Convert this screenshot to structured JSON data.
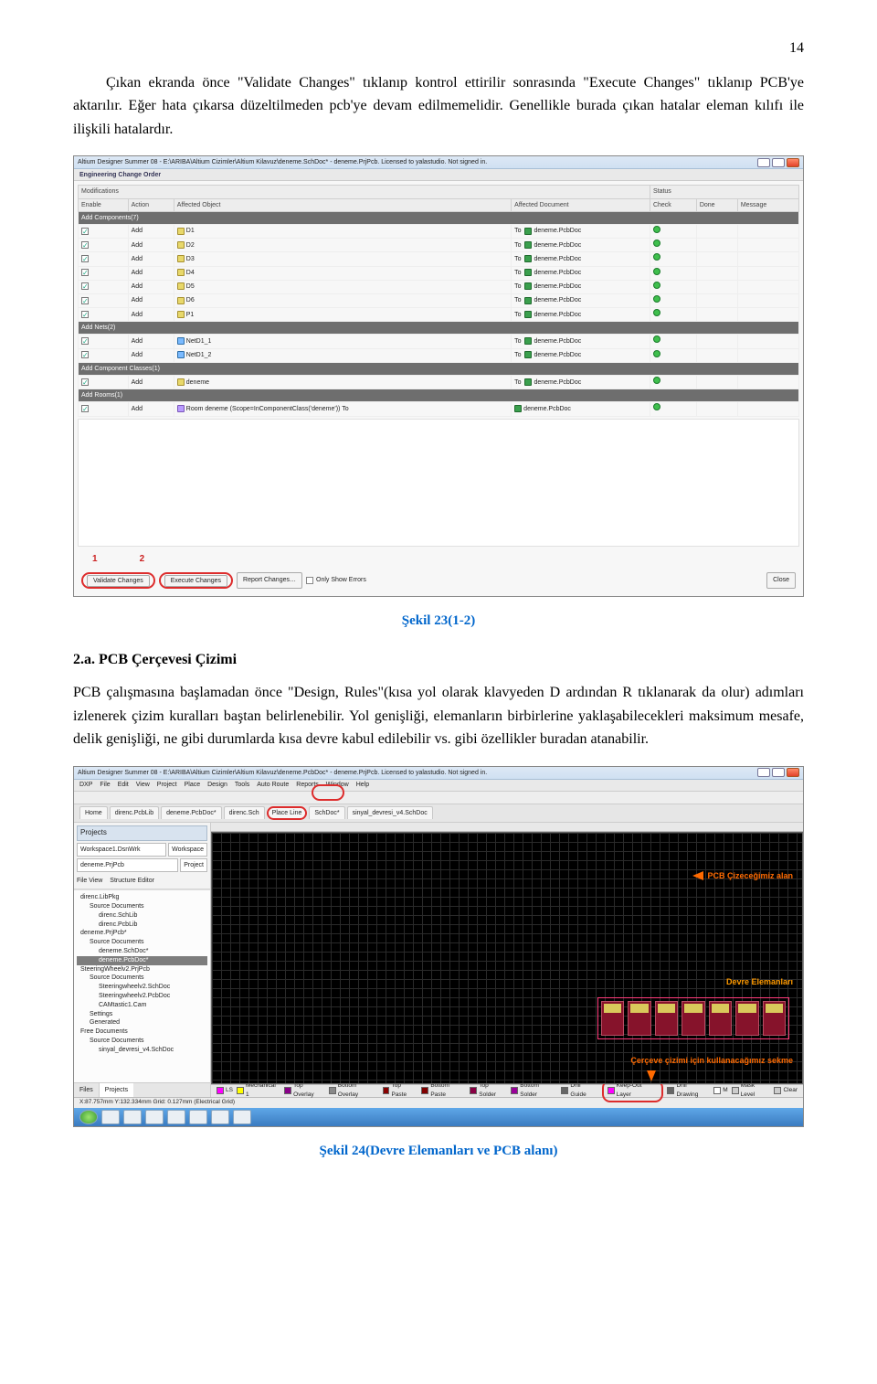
{
  "page_number": "14",
  "paragraphs": {
    "p1": "Çıkan ekranda önce \"Validate Changes\" tıklanıp kontrol ettirilir sonrasında \"Execute Changes\" tıklanıp PCB'ye aktarılır. Eğer hata çıkarsa düzeltilmeden pcb'ye devam edilmemelidir. Genellikle burada çıkan hatalar eleman kılıfı ile ilişkili hatalardır.",
    "p2": "PCB çalışmasına başlamadan önce \"Design, Rules\"(kısa yol olarak klavyeden D ardından R tıklanarak da olur) adımları izlenerek çizim kuralları baştan belirlenebilir. Yol genişliği, elemanların birbirlerine yaklaşabilecekleri maksimum mesafe, delik genişliği, ne gibi durumlarda kısa devre kabul edilebilir vs. gibi özellikler buradan atanabilir."
  },
  "captions": {
    "c1": "Şekil 23(1-2)",
    "c2": "Şekil 24(Devre Elemanları ve PCB alanı)"
  },
  "headings": {
    "h1": "2.a. PCB Çerçevesi Çizimi"
  },
  "eco": {
    "title": "Altium Designer Summer 08 - E:\\ARIBA\\Altium Cizimler\\Altium Kilavuz\\deneme.SchDoc* - deneme.PrjPcb. Licensed to yalastudio. Not signed in.",
    "dialog_title": "Engineering Change Order",
    "header": {
      "modifications": "Modifications",
      "enable": "Enable",
      "action": "Action",
      "affobj": "Affected Object",
      "affdoc": "Affected Document",
      "status": "Status",
      "check": "Check",
      "done": "Done",
      "message": "Message"
    },
    "groups": {
      "g1": "Add Components(7)",
      "g2": "Add Nets(2)",
      "g3": "Add Component Classes(1)",
      "g4": "Add Rooms(1)"
    },
    "rows": [
      {
        "action": "Add",
        "obj": "D1",
        "doc": "deneme.PcbDoc"
      },
      {
        "action": "Add",
        "obj": "D2",
        "doc": "deneme.PcbDoc"
      },
      {
        "action": "Add",
        "obj": "D3",
        "doc": "deneme.PcbDoc"
      },
      {
        "action": "Add",
        "obj": "D4",
        "doc": "deneme.PcbDoc"
      },
      {
        "action": "Add",
        "obj": "D5",
        "doc": "deneme.PcbDoc"
      },
      {
        "action": "Add",
        "obj": "D6",
        "doc": "deneme.PcbDoc"
      },
      {
        "action": "Add",
        "obj": "P1",
        "doc": "deneme.PcbDoc"
      }
    ],
    "netrows": [
      {
        "action": "Add",
        "obj": "NetD1_1",
        "doc": "deneme.PcbDoc"
      },
      {
        "action": "Add",
        "obj": "NetD1_2",
        "doc": "deneme.PcbDoc"
      }
    ],
    "classrow": {
      "action": "Add",
      "obj": "deneme",
      "doc": "deneme.PcbDoc"
    },
    "roomrow": {
      "action": "Add",
      "obj": "Room deneme (Scope=InComponentClass('deneme')) To",
      "doc": "deneme.PcbDoc"
    },
    "to": "To",
    "buttons": {
      "validate": "Validate Changes",
      "execute": "Execute Changes",
      "report": "Report Changes…",
      "errors": "Only Show Errors",
      "close": "Close"
    },
    "nums": {
      "n1": "1",
      "n2": "2"
    }
  },
  "ad": {
    "title": "Altium Designer Summer 08 - E:\\ARIBA\\Altium Cizimler\\Altium Kilavuz\\deneme.PcbDoc* - deneme.PrjPcb. Licensed to yalastudio. Not signed in.",
    "menus": [
      "DXP",
      "File",
      "Edit",
      "View",
      "Project",
      "Place",
      "Design",
      "Tools",
      "Auto Route",
      "Reports",
      "Window",
      "Help"
    ],
    "tabs": [
      "Home",
      "direnc.PcbLib",
      "deneme.PcbDoc*",
      "direnc.Sch",
      "Place Line",
      "SchDoc*",
      "sinyal_devresi_v4.SchDoc"
    ],
    "side": {
      "panel": "Projects",
      "workspace": "Workspace1.DsnWrk",
      "wbtn": "Workspace",
      "project": "deneme.PrjPcb",
      "pbtn": "Project",
      "view": "File View",
      "struct": "Structure Editor",
      "tree": [
        "direnc.LibPkg",
        "  Source Documents",
        "    direnc.SchLib",
        "    direnc.PcbLib",
        "deneme.PrjPcb*",
        "  Source Documents",
        "    deneme.SchDoc*",
        "    deneme.PcbDoc*",
        "SteeringWheelv2.PrjPcb",
        "  Source Documents",
        "    Steeringwheelv2.SchDoc",
        "    Steeringwheelv2.PcbDoc",
        "    CAMtastic1.Cam",
        "  Settings",
        "  Generated",
        "Free Documents",
        "  Source Documents",
        "    sinyal_devresi_v4.SchDoc"
      ],
      "selected_index": 7
    },
    "notes": {
      "n_area": "PCB Çizeceğimiz alan",
      "n_elems": "Devre Elemanları",
      "n_frame": "Çerçeve çizimi için kullanacağımız sekme"
    },
    "layers": [
      "LS",
      "Mechanical 1",
      "Top Overlay",
      "Bottom Overlay",
      "Top Paste",
      "Bottom Paste",
      "Top Solder",
      "Bottom Solder",
      "Drill Guide",
      "Keep-Out Layer",
      "Drill Drawing",
      "M",
      "Mask Level",
      "Clear"
    ],
    "layer_colors": [
      "#f0f",
      "#ff0",
      "#808",
      "#888",
      "#800",
      "#800000",
      "#804",
      "#909",
      "#666",
      "#f0f",
      "#666",
      "#fff",
      "#ccc",
      "#ccc"
    ],
    "status": "X:87.757mm Y:132.334mm   Grid: 0.127mm   (Electrical Grid)",
    "files_proj": [
      "Files",
      "Projects"
    ]
  }
}
